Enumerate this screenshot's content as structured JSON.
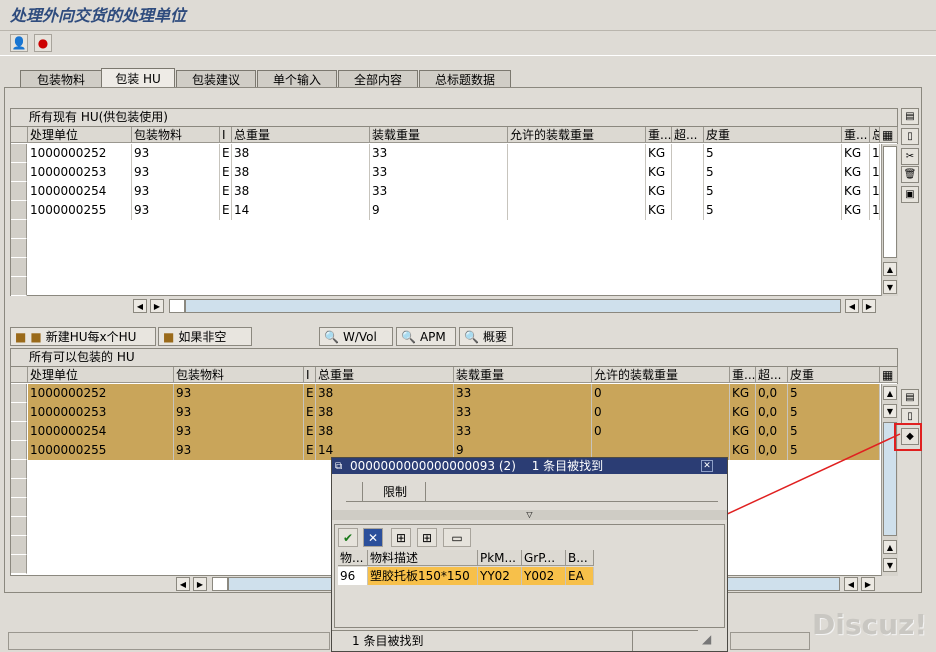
{
  "page_title": "处理外向交货的处理单位",
  "tabs": [
    {
      "label": "包装物料"
    },
    {
      "label": "包装 HU"
    },
    {
      "label": "包装建议"
    },
    {
      "label": "单个输入"
    },
    {
      "label": "全部内容"
    },
    {
      "label": "总标题数据"
    }
  ],
  "top": {
    "section_title": "所有现有 HU(供包装使用)",
    "columns": [
      "处理单位",
      "包装物料",
      "I",
      "总重量",
      "装载重量",
      "允许的装载重量",
      "重...",
      "超...",
      "皮重",
      "重...",
      "总..."
    ],
    "rows": [
      [
        "1000000252",
        "93",
        "E",
        "38",
        "33",
        "",
        "KG",
        "",
        "5",
        "KG",
        "1"
      ],
      [
        "1000000253",
        "93",
        "E",
        "38",
        "33",
        "",
        "KG",
        "",
        "5",
        "KG",
        "1"
      ],
      [
        "1000000254",
        "93",
        "E",
        "38",
        "33",
        "",
        "KG",
        "",
        "5",
        "KG",
        "1"
      ],
      [
        "1000000255",
        "93",
        "E",
        "14",
        "9",
        "",
        "KG",
        "",
        "5",
        "KG",
        "1"
      ]
    ]
  },
  "actions": {
    "new_hu": "新建HU每x个HU",
    "if_not_empty": "如果非空",
    "wvol": "W/Vol",
    "apm": "APM",
    "overview": "概要"
  },
  "bottom": {
    "section_title": "所有可以包装的 HU",
    "columns": [
      "处理单位",
      "包装物料",
      "I",
      "总重量",
      "装载重量",
      "允许的装载重量",
      "重...",
      "超...",
      "皮重"
    ],
    "rows": [
      [
        "1000000252",
        "93",
        "E",
        "38",
        "33",
        "0",
        "KG",
        "0,0",
        "5"
      ],
      [
        "1000000253",
        "93",
        "E",
        "38",
        "33",
        "0",
        "KG",
        "0,0",
        "5"
      ],
      [
        "1000000254",
        "93",
        "E",
        "38",
        "33",
        "0",
        "KG",
        "0,0",
        "5"
      ],
      [
        "1000000255",
        "93",
        "E",
        "14",
        "9",
        "",
        "KG",
        "0,0",
        "5"
      ]
    ]
  },
  "popup": {
    "title": "0000000000000000093 (2)",
    "found_title": "1 条目被找到",
    "restrict_tab": "限制",
    "columns": [
      "物...",
      "物料描述",
      "PkM...",
      "GrP...",
      "B..."
    ],
    "row": [
      "96",
      "塑胶托板150*150",
      "YY02",
      "Y002",
      "EA"
    ],
    "status": "1 条目被找到"
  },
  "watermark": "Discuz!",
  "colors": {
    "highlight": "#c9a55a",
    "popup_title": "#2b3d74",
    "arrow": "#e02020"
  }
}
